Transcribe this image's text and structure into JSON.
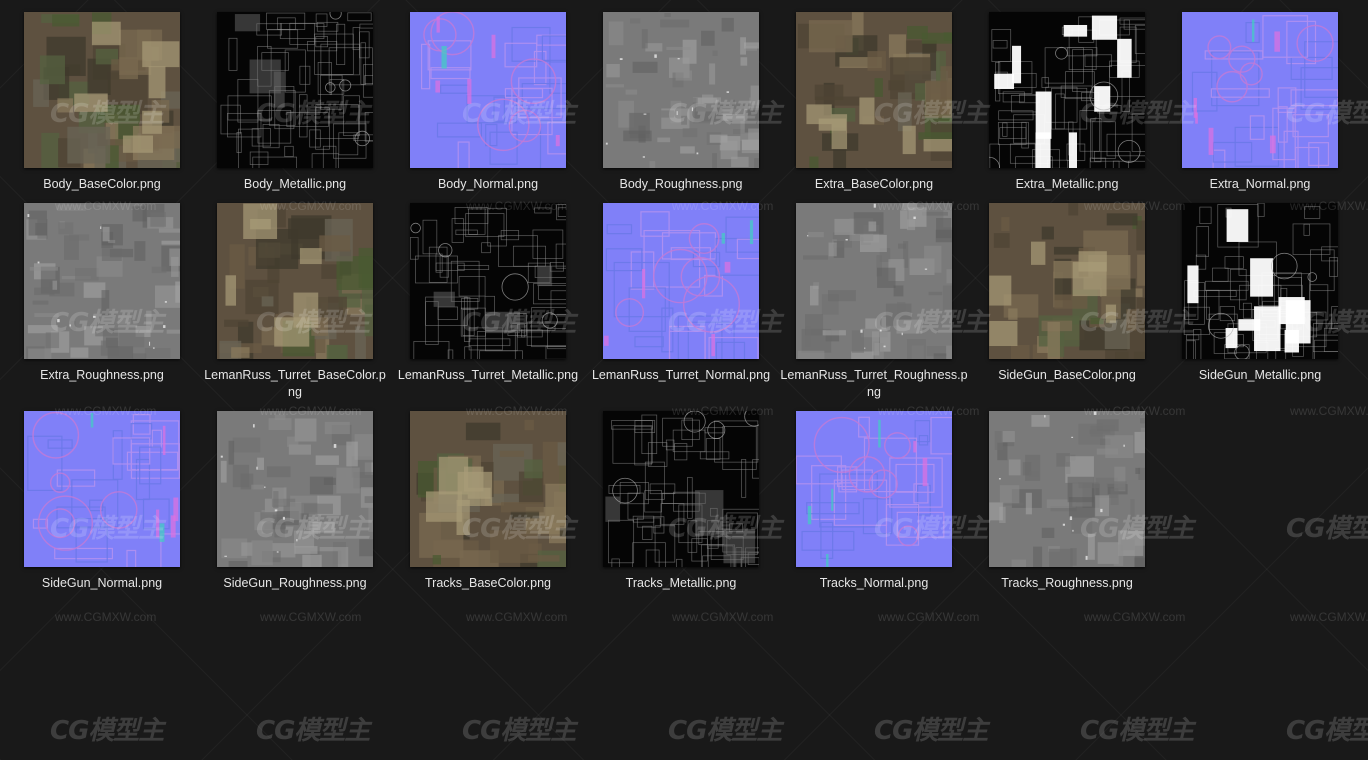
{
  "files": [
    {
      "name": "Body_BaseColor.png",
      "kind": "basecolor"
    },
    {
      "name": "Body_Metallic.png",
      "kind": "metallic"
    },
    {
      "name": "Body_Normal.png",
      "kind": "normal"
    },
    {
      "name": "Body_Roughness.png",
      "kind": "roughness"
    },
    {
      "name": "Extra_BaseColor.png",
      "kind": "basecolor"
    },
    {
      "name": "Extra_Metallic.png",
      "kind": "metallic-bright"
    },
    {
      "name": "Extra_Normal.png",
      "kind": "normal"
    },
    {
      "name": "Extra_Roughness.png",
      "kind": "roughness"
    },
    {
      "name": "LemanRuss_Turret_BaseColor.png",
      "kind": "basecolor"
    },
    {
      "name": "LemanRuss_Turret_Metallic.png",
      "kind": "metallic"
    },
    {
      "name": "LemanRuss_Turret_Normal.png",
      "kind": "normal"
    },
    {
      "name": "LemanRuss_Turret_Roughness.png",
      "kind": "roughness"
    },
    {
      "name": "SideGun_BaseColor.png",
      "kind": "basecolor"
    },
    {
      "name": "SideGun_Metallic.png",
      "kind": "metallic-bright"
    },
    {
      "name": "SideGun_Normal.png",
      "kind": "normal"
    },
    {
      "name": "SideGun_Roughness.png",
      "kind": "roughness"
    },
    {
      "name": "Tracks_BaseColor.png",
      "kind": "basecolor"
    },
    {
      "name": "Tracks_Metallic.png",
      "kind": "metallic"
    },
    {
      "name": "Tracks_Normal.png",
      "kind": "normal"
    },
    {
      "name": "Tracks_Roughness.png",
      "kind": "roughness"
    }
  ],
  "watermark": {
    "logo": "CG模型主",
    "url": "www.CGMXW.com"
  },
  "colors": {
    "background": "#191919",
    "label": "#e6e6e6"
  }
}
